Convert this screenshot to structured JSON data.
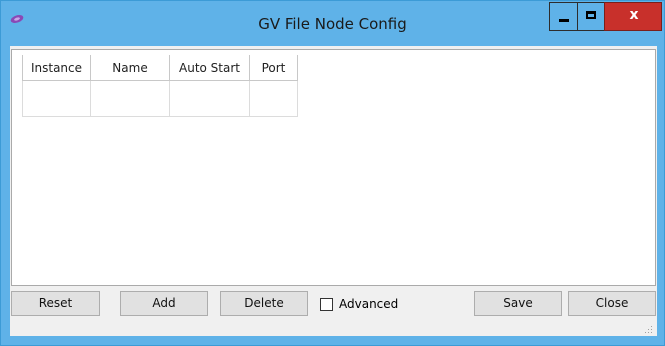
{
  "window": {
    "title": "GV File Node Config",
    "close_label": "x"
  },
  "grid": {
    "columns": [
      "Instance",
      "Name",
      "Auto Start",
      "Port"
    ]
  },
  "toolbar": {
    "reset_label": "Reset",
    "add_label": "Add",
    "delete_label": "Delete",
    "advanced_label": "Advanced",
    "advanced_checked": false,
    "save_label": "Save",
    "close_label": "Close"
  },
  "colors": {
    "titlebar": "#5fb2e8",
    "close_button": "#c8302b"
  },
  "icons": [
    "app-icon",
    "minimize-icon",
    "maximize-icon",
    "close-icon",
    "resize-grip-icon"
  ]
}
